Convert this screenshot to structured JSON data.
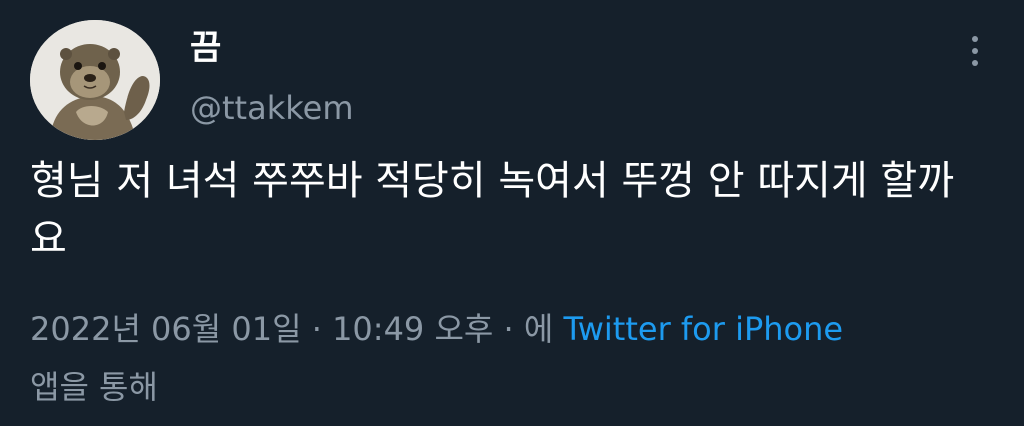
{
  "tweet": {
    "author": {
      "display_name": "끔",
      "handle": "@ttakkem",
      "avatar_icon": "otter-avatar"
    },
    "more_icon": "more-vertical-icon",
    "text": "형님 저 녀석 쭈쭈바 적당히 녹여서 뚜껑 안 따지게 할까요",
    "timestamp": {
      "date": "2022년 06월 01일",
      "separator_1": " · ",
      "time": "10:49 오후",
      "separator_2": " · ",
      "via_prefix": "에 ",
      "source": "Twitter for iPhone",
      "via_suffix": "앱을 통해"
    },
    "colors": {
      "background": "#15202b",
      "text": "#ffffff",
      "secondary": "#8b98a5",
      "link": "#1d9bf0"
    }
  }
}
